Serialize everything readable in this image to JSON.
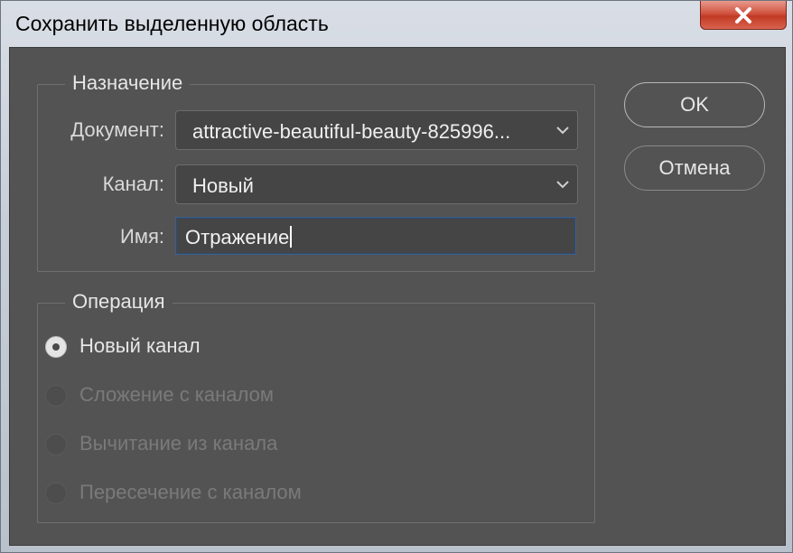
{
  "window": {
    "title": "Сохранить выделенную область"
  },
  "destination": {
    "legend": "Назначение",
    "document_label": "Документ:",
    "document_value": "attractive-beautiful-beauty-825996...",
    "channel_label": "Канал:",
    "channel_value": "Новый",
    "name_label": "Имя:",
    "name_value": "Отражение"
  },
  "operation": {
    "legend": "Операция",
    "options": [
      {
        "label": "Новый канал",
        "selected": true,
        "enabled": true
      },
      {
        "label": "Сложение с каналом",
        "selected": false,
        "enabled": false
      },
      {
        "label": "Вычитание из канала",
        "selected": false,
        "enabled": false
      },
      {
        "label": "Пересечение с каналом",
        "selected": false,
        "enabled": false
      }
    ]
  },
  "buttons": {
    "ok_label": "OK",
    "cancel_label": "Отмена"
  },
  "icons": {
    "close": "close-icon",
    "dropdown": "chevron-down-icon"
  },
  "colors": {
    "panel_bg": "#535353",
    "field_bg": "#454545",
    "focus_border": "#3f5f8a",
    "close_red": "#c13a24"
  }
}
